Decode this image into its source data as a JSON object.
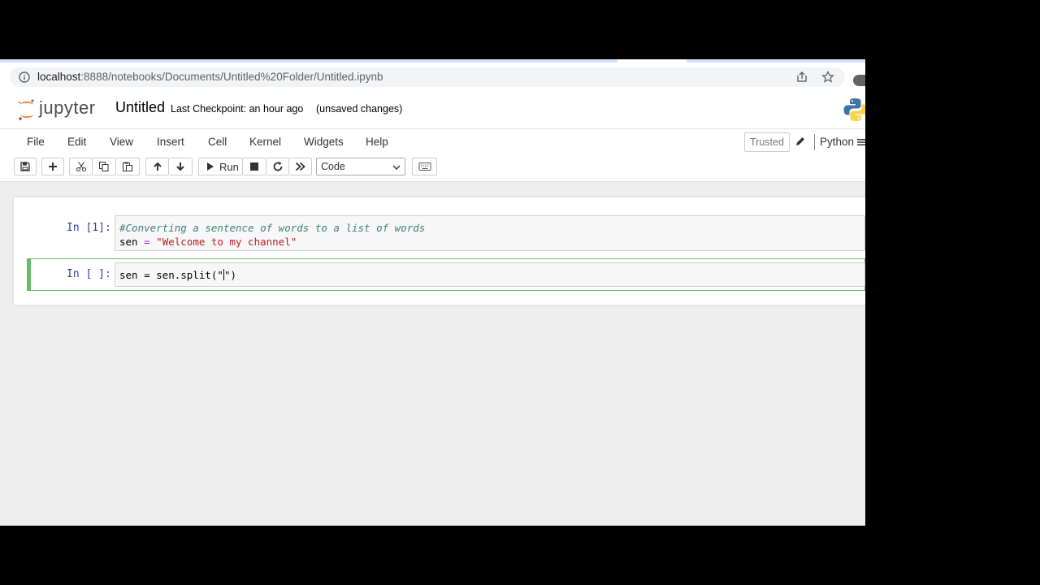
{
  "browser": {
    "url_host": "localhost",
    "url_rest": ":8888/notebooks/Documents/Untitled%20Folder/Untitled.ipynb"
  },
  "header": {
    "logo_text": "jupyter",
    "notebook_title": "Untitled",
    "checkpoint": "Last Checkpoint: an hour ago",
    "unsaved": "(unsaved changes)"
  },
  "menu": {
    "items": [
      "File",
      "Edit",
      "View",
      "Insert",
      "Cell",
      "Kernel",
      "Widgets",
      "Help"
    ],
    "trusted_label": "Trusted",
    "kernel_name": "Python"
  },
  "toolbar": {
    "run_label": "Run",
    "cell_type": "Code"
  },
  "cells": [
    {
      "prompt": "In [1]:",
      "line1": "#Converting a sentence of words to a list of words",
      "line2_var": "sen",
      "line2_op": "=",
      "line2_str": "\"Welcome to my channel\""
    },
    {
      "prompt": "In [ ]:",
      "code_before_cursor": "sen = sen.split(\"",
      "code_after_cursor": "\")"
    }
  ],
  "colors": {
    "selected_cell_border": "#66bb6a",
    "prompt_color": "#303f9f",
    "comment_color": "#408080",
    "string_color": "#ba2121",
    "operator_color": "#aa22ff"
  }
}
